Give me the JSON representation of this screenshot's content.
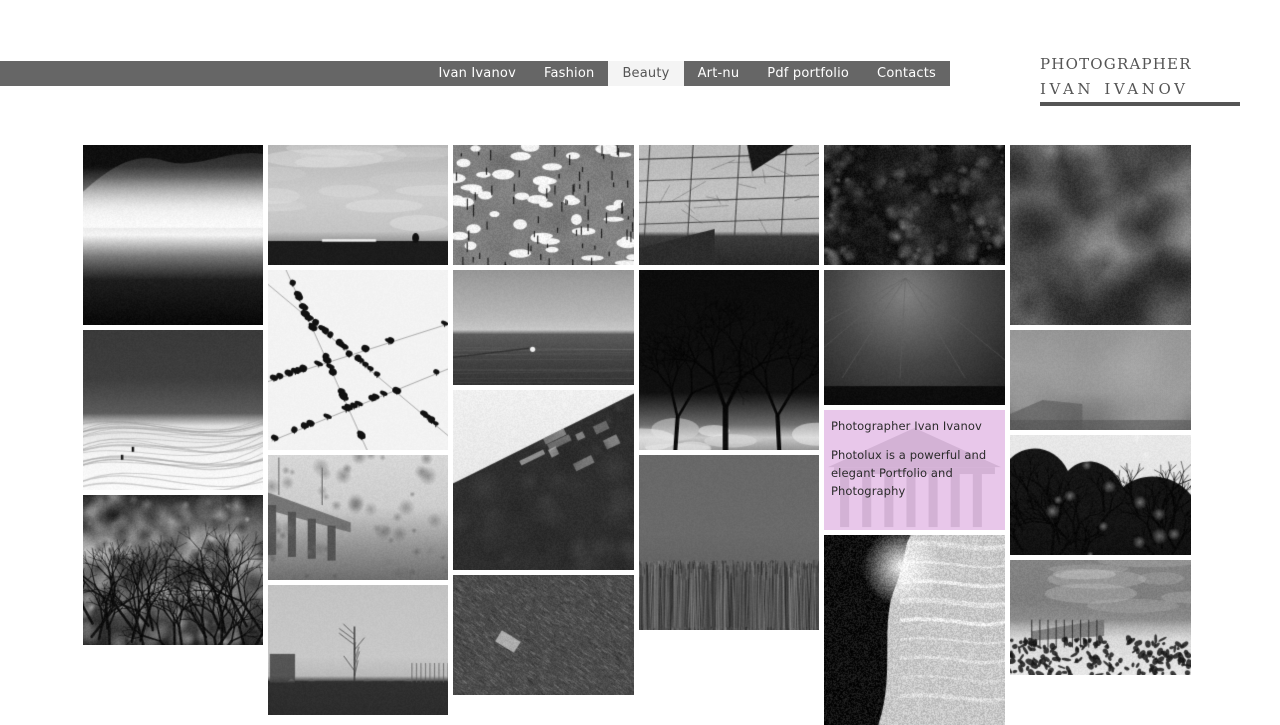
{
  "site": {
    "logo_line1": "Photographer",
    "logo_line2": "Ivan Ivanov",
    "background_color": "#ffffff"
  },
  "nav": {
    "background_color": "#666666",
    "active_background_color": "#f4f4f4",
    "active_text_color": "#555555",
    "text_color": "#ffffff",
    "items": [
      {
        "label": "Ivan Ivanov",
        "active": false
      },
      {
        "label": "Fashion",
        "active": false
      },
      {
        "label": "Beauty",
        "active": true
      },
      {
        "label": "Art-nu",
        "active": false
      },
      {
        "label": "Pdf portfolio",
        "active": false
      },
      {
        "label": "Contacts",
        "active": false
      }
    ]
  },
  "promo": {
    "background_color": "#e8c7ea",
    "title": "Photographer  Ivan Ivanov",
    "body": "Photolux is a powerful and elegant Portfolio and Photography"
  },
  "gallery": {
    "columns": [
      {
        "id": "col-1",
        "tiles": [
          {
            "name": "misty-mountain-ridge",
            "height": 180,
            "art": "mountain-fog"
          },
          {
            "name": "snow-field-skiers",
            "height": 160,
            "art": "snow-field"
          },
          {
            "name": "bushland-trees-dark",
            "height": 150,
            "art": "dark-bush"
          }
        ]
      },
      {
        "id": "col-2",
        "tiles": [
          {
            "name": "cloudy-field-horizon",
            "height": 120,
            "art": "cloud-field"
          },
          {
            "name": "birds-on-wires",
            "height": 180,
            "art": "birds-wires"
          },
          {
            "name": "bridge-overpass-scrub",
            "height": 125,
            "art": "bridge"
          },
          {
            "name": "foggy-park-playground",
            "height": 130,
            "art": "foggy-park"
          }
        ]
      },
      {
        "id": "col-3",
        "tiles": [
          {
            "name": "beach-umbrellas-aerial",
            "height": 120,
            "art": "beach-umbrellas"
          },
          {
            "name": "sea-horizon-boat",
            "height": 115,
            "art": "sea-horizon"
          },
          {
            "name": "mountain-slope-snow",
            "height": 180,
            "art": "mountain-slope"
          },
          {
            "name": "hillside-cabin",
            "height": 120,
            "art": "hillside"
          }
        ]
      },
      {
        "id": "col-4",
        "tiles": [
          {
            "name": "concrete-wall-geometry",
            "height": 120,
            "art": "concrete-wall"
          },
          {
            "name": "bare-tree-silhouette",
            "height": 180,
            "art": "bare-tree"
          },
          {
            "name": "reed-grass-field",
            "height": 175,
            "art": "reeds"
          }
        ]
      },
      {
        "id": "col-5",
        "tiles": [
          {
            "name": "blurred-foliage-bokeh",
            "height": 120,
            "art": "foliage-bokeh"
          },
          {
            "name": "wires-vanishing-point",
            "height": 135,
            "art": "wires-vanish"
          },
          {
            "name": "promo-card",
            "height": 120,
            "art": "promo"
          },
          {
            "name": "shoreline-waves",
            "height": 190,
            "art": "shoreline"
          }
        ]
      },
      {
        "id": "col-6",
        "tiles": [
          {
            "name": "cloudscape-abstract",
            "height": 180,
            "art": "cloudscape"
          },
          {
            "name": "fog-over-hills",
            "height": 100,
            "art": "fog-hills"
          },
          {
            "name": "dark-tree-canopy",
            "height": 120,
            "art": "tree-canopy"
          },
          {
            "name": "snowy-fence-dune",
            "height": 115,
            "art": "snowy-fence"
          }
        ]
      }
    ]
  }
}
